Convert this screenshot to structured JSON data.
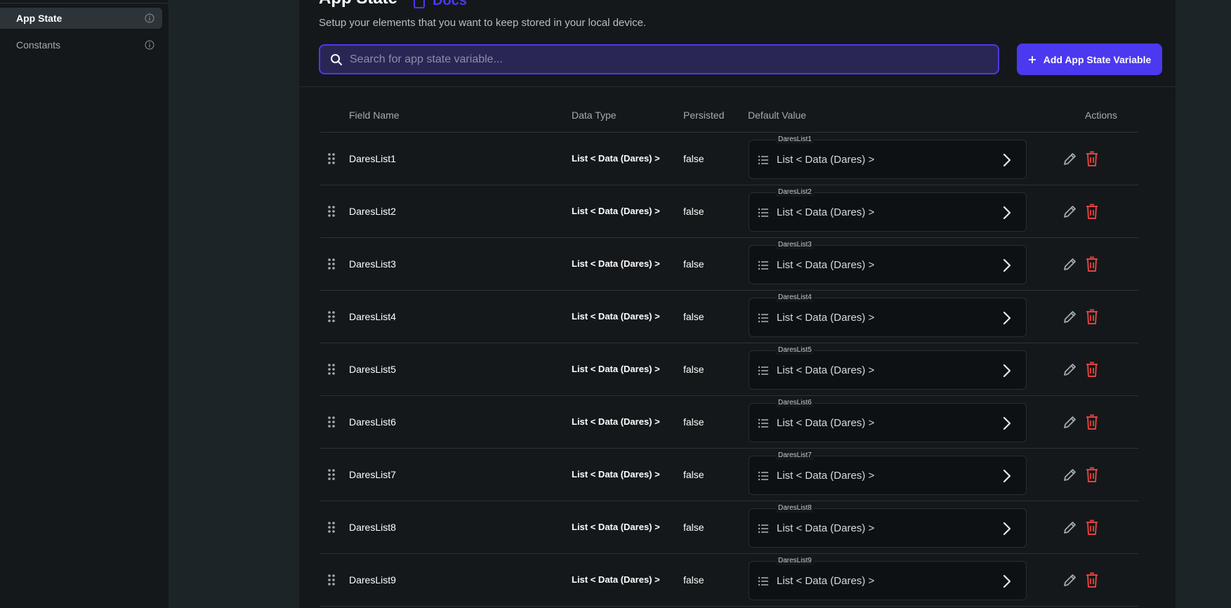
{
  "sidebar": {
    "items": [
      {
        "label": "App State",
        "active": true
      },
      {
        "label": "Constants",
        "active": false
      }
    ]
  },
  "header": {
    "title": "App State",
    "docs_label": "Docs",
    "subtitle": "Setup your elements that you want to keep stored in your local device."
  },
  "search": {
    "placeholder": "Search for app state variable...",
    "value": ""
  },
  "add_button": {
    "label": "Add App State Variable"
  },
  "table": {
    "columns": {
      "field_name": "Field Name",
      "data_type": "Data Type",
      "persisted": "Persisted",
      "default_value": "Default Value",
      "actions": "Actions"
    },
    "rows": [
      {
        "name": "DaresList1",
        "type": "List < Data (Dares) >",
        "persisted": "false",
        "default_label": "DaresList1",
        "default_value": "List < Data (Dares) >"
      },
      {
        "name": "DaresList2",
        "type": "List < Data (Dares) >",
        "persisted": "false",
        "default_label": "DaresList2",
        "default_value": "List < Data (Dares) >"
      },
      {
        "name": "DaresList3",
        "type": "List < Data (Dares) >",
        "persisted": "false",
        "default_label": "DaresList3",
        "default_value": "List < Data (Dares) >"
      },
      {
        "name": "DaresList4",
        "type": "List < Data (Dares) >",
        "persisted": "false",
        "default_label": "DaresList4",
        "default_value": "List < Data (Dares) >"
      },
      {
        "name": "DaresList5",
        "type": "List < Data (Dares) >",
        "persisted": "false",
        "default_label": "DaresList5",
        "default_value": "List < Data (Dares) >"
      },
      {
        "name": "DaresList6",
        "type": "List < Data (Dares) >",
        "persisted": "false",
        "default_label": "DaresList6",
        "default_value": "List < Data (Dares) >"
      },
      {
        "name": "DaresList7",
        "type": "List < Data (Dares) >",
        "persisted": "false",
        "default_label": "DaresList7",
        "default_value": "List < Data (Dares) >"
      },
      {
        "name": "DaresList8",
        "type": "List < Data (Dares) >",
        "persisted": "false",
        "default_label": "DaresList8",
        "default_value": "List < Data (Dares) >"
      },
      {
        "name": "DaresList9",
        "type": "List < Data (Dares) >",
        "persisted": "false",
        "default_label": "DaresList9",
        "default_value": "List < Data (Dares) >"
      }
    ]
  },
  "colors": {
    "accent": "#4b39ef",
    "delete": "#e0433f",
    "background": "#14181b"
  },
  "icons": {
    "search": "search-icon",
    "add": "plus-icon",
    "drag": "drag-handle-icon",
    "list": "list-icon",
    "chevron": "chevron-right-icon",
    "edit": "pencil-icon",
    "delete": "trash-icon",
    "info": "info-icon",
    "docs": "docs-icon"
  }
}
